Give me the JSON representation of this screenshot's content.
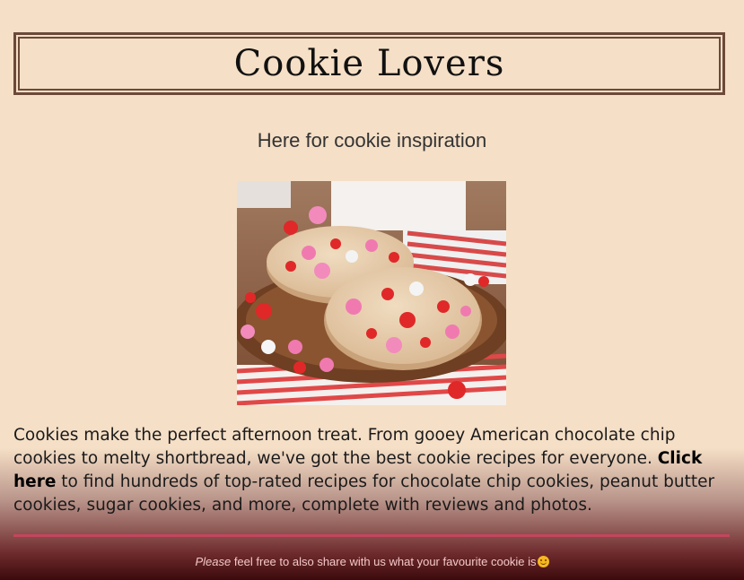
{
  "header": {
    "title": "Cookie Lovers"
  },
  "tagline": "Here for cookie inspiration",
  "intro": {
    "text_before": "Cookies make the perfect afternoon treat. From gooey American chocolate chip cookies to melty shortbread, we've got the best cookie recipes for everyone. ",
    "link_text": "Click here",
    "text_after": " to find hundreds of top-rated recipes for chocolate chip cookies, peanut butter cookies, sugar cookies, and more, complete with reviews and photos."
  },
  "footer": {
    "emphasis": "Please",
    "text": " feel free to also share with us what your favourite cookie is",
    "emoji_icon": "smiling-face-icon"
  },
  "colors": {
    "background": "#f5dfc6",
    "border": "#6b4a3a",
    "divider": "#c4455f",
    "footer_dark": "#3b0a0c"
  }
}
